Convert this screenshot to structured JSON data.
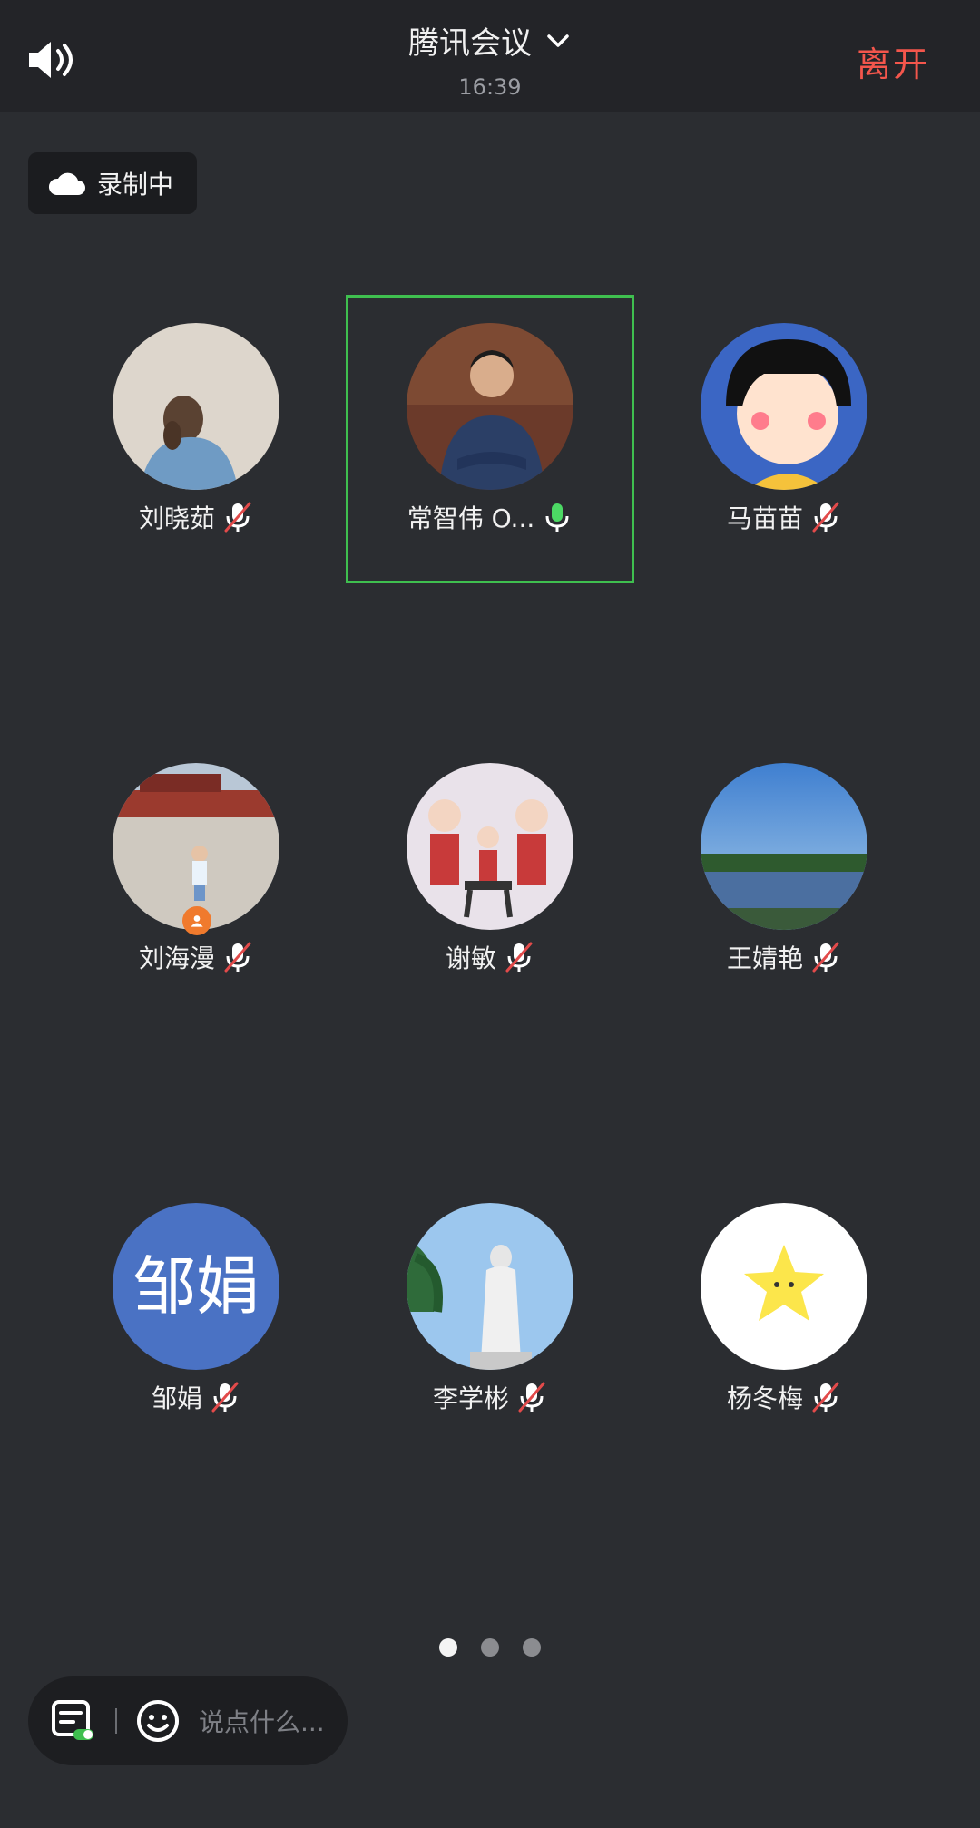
{
  "header": {
    "title": "腾讯会议",
    "time": "16:39",
    "leave_label": "离开"
  },
  "recording": {
    "label": "录制中"
  },
  "participants": [
    {
      "name": "刘晓茹",
      "mic": "muted"
    },
    {
      "name": "常智伟 O...",
      "mic": "active"
    },
    {
      "name": "马苗苗",
      "mic": "muted"
    },
    {
      "name": "刘海漫",
      "mic": "muted"
    },
    {
      "name": "谢敏",
      "mic": "muted"
    },
    {
      "name": "王婧艳",
      "mic": "muted"
    },
    {
      "name": "邹娟",
      "mic": "muted",
      "avatar_text": "邹娟",
      "avatar_color": "#4a72c4"
    },
    {
      "name": "李学彬",
      "mic": "muted"
    },
    {
      "name": "杨冬梅",
      "mic": "muted"
    }
  ],
  "pager": {
    "pages": 3,
    "current": 1
  },
  "chat": {
    "placeholder": "说点什么..."
  },
  "colors": {
    "accent_green": "#3fbf4f",
    "leave_red": "#f4564c",
    "background": "#2b2d31"
  }
}
